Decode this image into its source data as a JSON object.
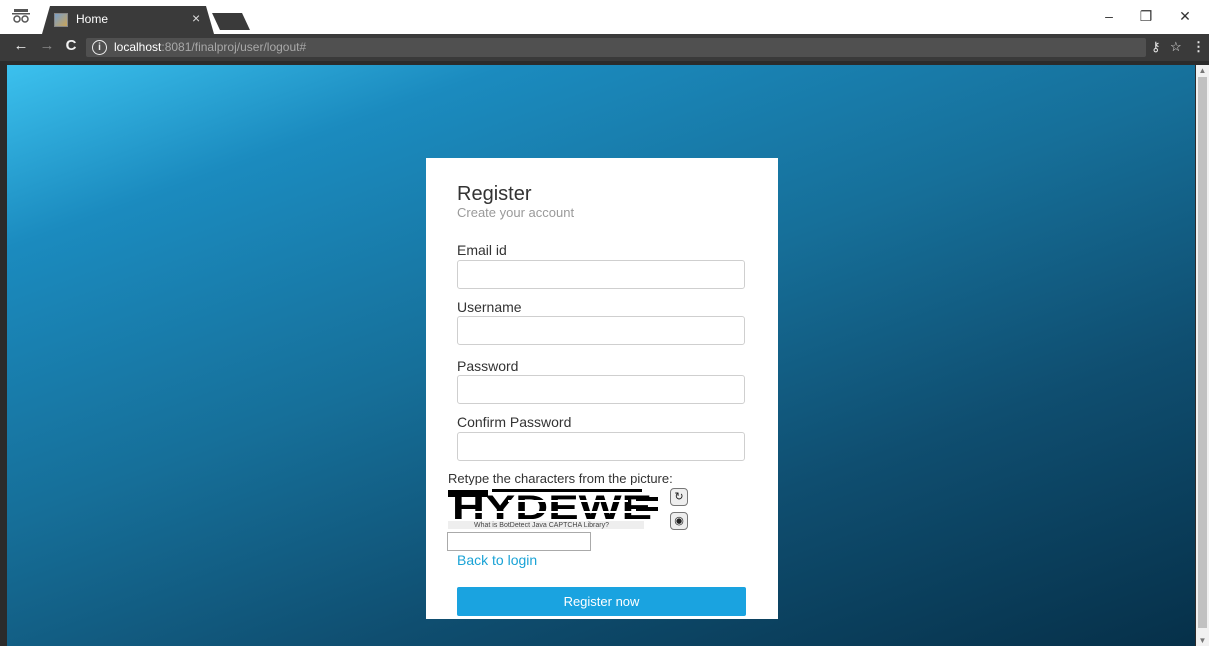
{
  "browser": {
    "tab_title": "Home",
    "tab_close": "×",
    "url_host": "localhost",
    "url_rest": ":8081/finalproj/user/logout#",
    "incognito_icon": "incognito-icon",
    "window_controls": {
      "minimize": "–",
      "restore": "❐",
      "close": "✕"
    },
    "nav": {
      "back": "←",
      "forward": "→",
      "reload": "C"
    },
    "toolbar_icons": {
      "key": "⚷",
      "star": "☆",
      "menu": "⋮"
    }
  },
  "form": {
    "title": "Register",
    "subtitle": "Create your account",
    "fields": [
      {
        "label": "Email id",
        "value": ""
      },
      {
        "label": "Username",
        "value": ""
      },
      {
        "label": "Password",
        "value": ""
      },
      {
        "label": "Confirm Password",
        "value": ""
      }
    ],
    "captcha": {
      "prompt": "Retype the characters from the picture:",
      "image_text": "HYDEWE",
      "link_text": "What is BotDetect Java CAPTCHA Library?",
      "reload_icon": "reload-icon",
      "sound_icon": "speaker-icon"
    },
    "back_link": "Back to login",
    "submit_label": "Register now"
  },
  "colors": {
    "accent": "#1aa3e0",
    "link": "#1aa3d6",
    "bg_top": "#3cc1ee",
    "bg_bottom": "#063049"
  }
}
